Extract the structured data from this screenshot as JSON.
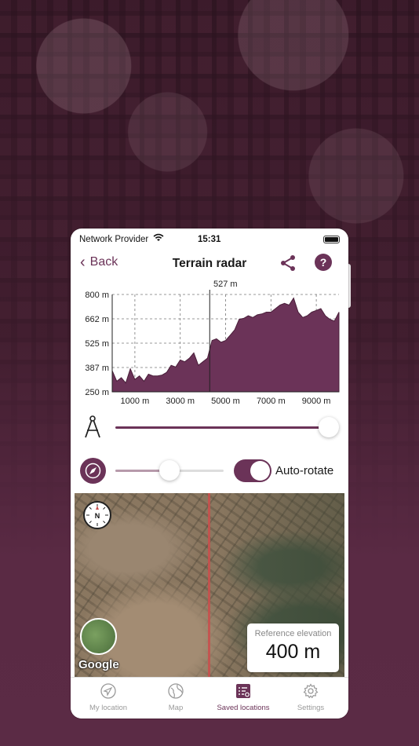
{
  "status": {
    "provider": "Network Provider",
    "time": "15:31"
  },
  "nav": {
    "back_label": "Back",
    "title": "Terrain radar",
    "help_label": "?"
  },
  "chart_data": {
    "type": "area",
    "title": "",
    "xlabel": "",
    "ylabel": "",
    "y_ticks": [
      "800 m",
      "662 m",
      "525 m",
      "387 m",
      "250 m"
    ],
    "x_ticks": [
      "1000 m",
      "3000 m",
      "5000 m",
      "7000 m",
      "9000 m"
    ],
    "ylim": [
      250,
      800
    ],
    "xlim": [
      0,
      10000
    ],
    "marker": {
      "x": 4300,
      "label": "527 m"
    },
    "x": [
      0,
      200,
      400,
      600,
      800,
      1000,
      1200,
      1400,
      1600,
      1800,
      2000,
      2200,
      2400,
      2600,
      2800,
      3000,
      3200,
      3400,
      3600,
      3800,
      4000,
      4200,
      4400,
      4600,
      4800,
      5000,
      5200,
      5400,
      5600,
      5800,
      6000,
      6200,
      6400,
      6600,
      6800,
      7000,
      7200,
      7400,
      7600,
      7800,
      8000,
      8200,
      8400,
      8600,
      8800,
      9000,
      9200,
      9400,
      9600,
      9800,
      10000
    ],
    "values": [
      370,
      310,
      330,
      300,
      380,
      320,
      340,
      310,
      350,
      340,
      340,
      345,
      360,
      400,
      390,
      430,
      420,
      440,
      470,
      400,
      420,
      440,
      540,
      550,
      530,
      540,
      570,
      600,
      660,
      665,
      680,
      670,
      685,
      690,
      700,
      700,
      720,
      740,
      750,
      740,
      780,
      700,
      670,
      680,
      700,
      710,
      720,
      680,
      660,
      650,
      700
    ],
    "grid": true,
    "fill_color": "#6b3358"
  },
  "controls": {
    "distance_slider": 1.0,
    "rotation_slider": 0.5,
    "auto_rotate_label": "Auto-rotate",
    "auto_rotate_on": true
  },
  "map": {
    "north_label": "N",
    "google_label": "Google",
    "ref_label": "Reference elevation",
    "ref_value": "400 m"
  },
  "tabs": [
    {
      "label": "My location",
      "icon": "location-arrow-icon",
      "active": false
    },
    {
      "label": "Map",
      "icon": "globe-icon",
      "active": false
    },
    {
      "label": "Saved locations",
      "icon": "list-icon",
      "active": true
    },
    {
      "label": "Settings",
      "icon": "gear-icon",
      "active": false
    }
  ],
  "colors": {
    "accent": "#6b3358"
  }
}
